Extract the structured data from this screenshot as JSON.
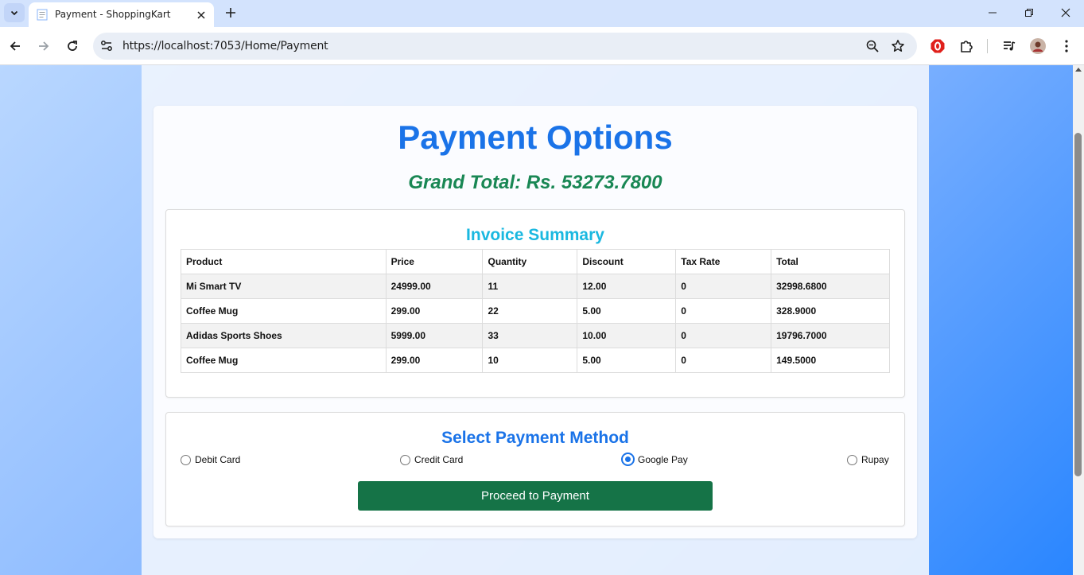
{
  "browser": {
    "tab_title": "Payment - ShoppingKart",
    "url": "https://localhost:7053/Home/Payment"
  },
  "page": {
    "title": "Payment Options",
    "grand_total": "Grand Total: Rs. 53273.7800"
  },
  "invoice": {
    "title": "Invoice Summary",
    "columns": [
      "Product",
      "Price",
      "Quantity",
      "Discount",
      "Tax Rate",
      "Total"
    ],
    "rows": [
      [
        "Mi Smart TV",
        "24999.00",
        "11",
        "12.00",
        "0",
        "32998.6800"
      ],
      [
        "Coffee Mug",
        "299.00",
        "22",
        "5.00",
        "0",
        "328.9000"
      ],
      [
        "Adidas Sports Shoes",
        "5999.00",
        "33",
        "10.00",
        "0",
        "19796.7000"
      ],
      [
        "Coffee Mug",
        "299.00",
        "10",
        "5.00",
        "0",
        "149.5000"
      ]
    ]
  },
  "payment": {
    "title": "Select Payment Method",
    "options": [
      {
        "label": "Debit Card",
        "selected": false
      },
      {
        "label": "Credit Card",
        "selected": false
      },
      {
        "label": "Google Pay",
        "selected": true
      },
      {
        "label": "Rupay",
        "selected": false
      }
    ],
    "proceed_label": "Proceed to Payment"
  },
  "colors": {
    "title_blue": "#1a73e8",
    "total_green": "#198754",
    "invoice_title": "#1ab8e0",
    "button_green": "#157347"
  }
}
